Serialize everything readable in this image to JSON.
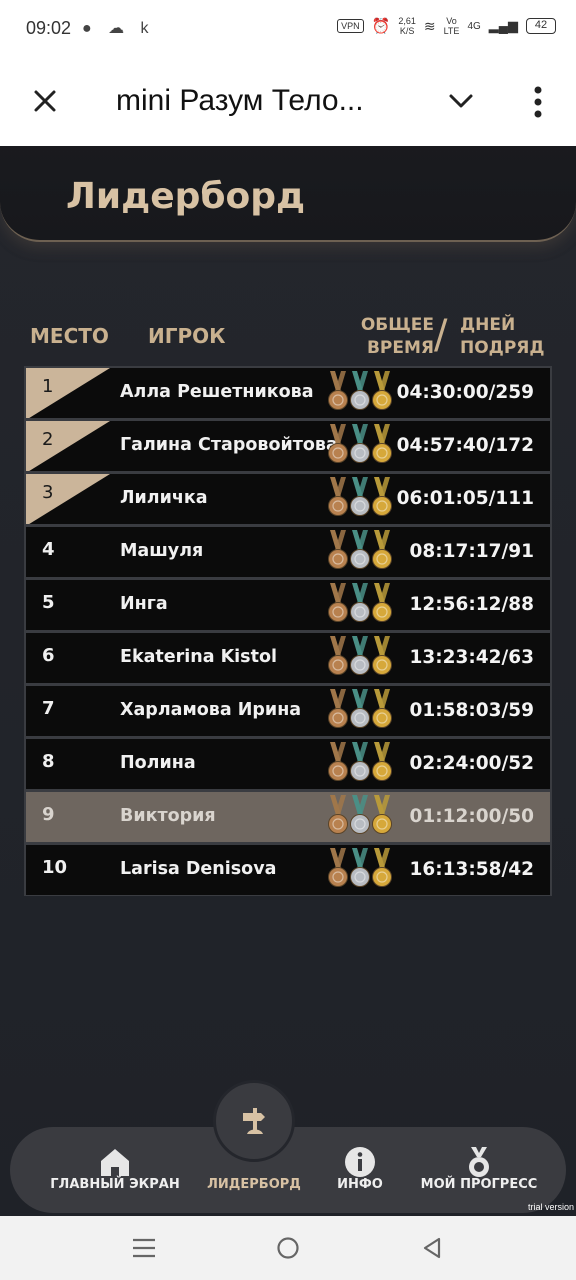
{
  "status_bar": {
    "time": "09:02",
    "speed_value": "2,61",
    "speed_unit": "K/S",
    "vpn": "VPN",
    "volte_top": "Vo",
    "volte_bottom": "LTE",
    "network": "4G",
    "battery": "42"
  },
  "app_bar": {
    "title": "mini Разум Тело..."
  },
  "screen": {
    "title": "Лидерборд",
    "columns": {
      "place": "МЕСТО",
      "player": "ИГРОК",
      "time_line1": "ОБЩЕЕ",
      "time_line2": "ВРЕМЯ",
      "separator": "/",
      "days_line1": "ДНЕЙ",
      "days_line2": "ПОДРЯД"
    },
    "rows": [
      {
        "place": "1",
        "name": "Алла Решетникова",
        "score": "04:30:00/259",
        "top": true,
        "current": false
      },
      {
        "place": "2",
        "name": "Галина Старовойтова",
        "score": "04:57:40/172",
        "top": true,
        "current": false
      },
      {
        "place": "3",
        "name": "Лиличка",
        "score": "06:01:05/111",
        "top": true,
        "current": false
      },
      {
        "place": "4",
        "name": "Машуля",
        "score": "08:17:17/91",
        "top": false,
        "current": false
      },
      {
        "place": "5",
        "name": "Инга",
        "score": "12:56:12/88",
        "top": false,
        "current": false
      },
      {
        "place": "6",
        "name": "Ekaterina Kistol",
        "score": "13:23:42/63",
        "top": false,
        "current": false
      },
      {
        "place": "7",
        "name": "Харламова Ирина",
        "score": "01:58:03/59",
        "top": false,
        "current": false
      },
      {
        "place": "8",
        "name": "Полина",
        "score": "02:24:00/52",
        "top": false,
        "current": false
      },
      {
        "place": "9",
        "name": "Виктория",
        "score": "01:12:00/50",
        "top": false,
        "current": true
      },
      {
        "place": "10",
        "name": "Larisa Denisova",
        "score": "16:13:58/42",
        "top": false,
        "current": false
      }
    ]
  },
  "bottom_nav": {
    "home": "ГЛАВНЫЙ ЭКРАН",
    "leaderboard": "ЛИДЕРБОРД",
    "info": "ИНФО",
    "progress": "МОЙ ПРОГРЕСС",
    "active": "leaderboard"
  },
  "watermark": "trial version",
  "colors": {
    "accent_gold": "#c9b18f",
    "top_rank_badge": "#cbb59a",
    "current_row": "#6e665f",
    "background": "#24262c"
  },
  "icons": [
    "close-icon",
    "chevron-down-icon",
    "more-vert-icon",
    "medal-bronze-icon",
    "medal-silver-icon",
    "medal-gold-icon",
    "home-icon",
    "signpost-icon",
    "info-icon",
    "medal-progress-icon",
    "menu-icon",
    "home-circle-icon",
    "back-icon"
  ]
}
